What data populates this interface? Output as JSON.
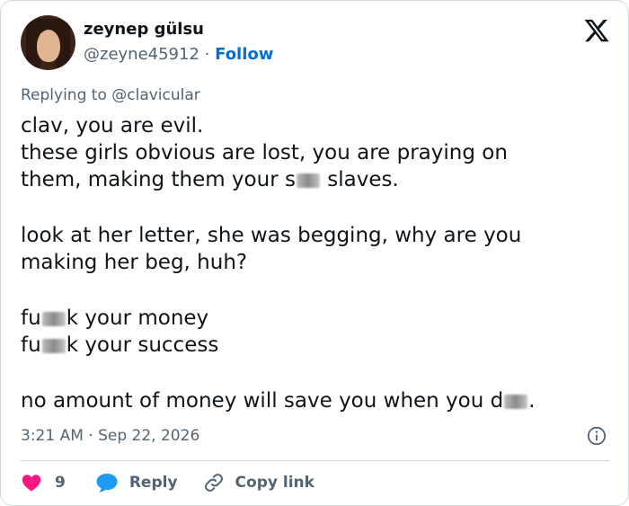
{
  "author": {
    "name": "zeynep gülsu",
    "handle": "@zeyne45912",
    "separator": "·",
    "follow_label": "Follow"
  },
  "reply_context": {
    "prefix": "Replying to ",
    "target": "@clavicular"
  },
  "tweet": {
    "line1": "clav, you are evil.",
    "line2": "these girls obvious are lost, you are praying on",
    "line3a": "them, making them your s",
    "line3b": " slaves.",
    "line4": "look at her letter, she was begging, why are you",
    "line5": "making her beg, huh?",
    "line6a": "fu",
    "line6b": "k your money",
    "line7a": "fu",
    "line7b": "k your success",
    "line8a": "no amount of money will save you when you d",
    "line8b": "."
  },
  "meta": {
    "time": "3:21 AM",
    "separator": "·",
    "date": "Sep 22, 2026"
  },
  "actions": {
    "like_count": "9",
    "reply_label": "Reply",
    "copy_label": "Copy link"
  },
  "colors": {
    "like": "#f91880",
    "reply": "#1d9bf0",
    "link": "#006fd6",
    "muted": "#536471"
  },
  "icons": {
    "logo": "x-logo-icon",
    "info": "info-icon",
    "like": "heart-icon",
    "reply": "speech-bubble-icon",
    "copy": "link-icon"
  }
}
